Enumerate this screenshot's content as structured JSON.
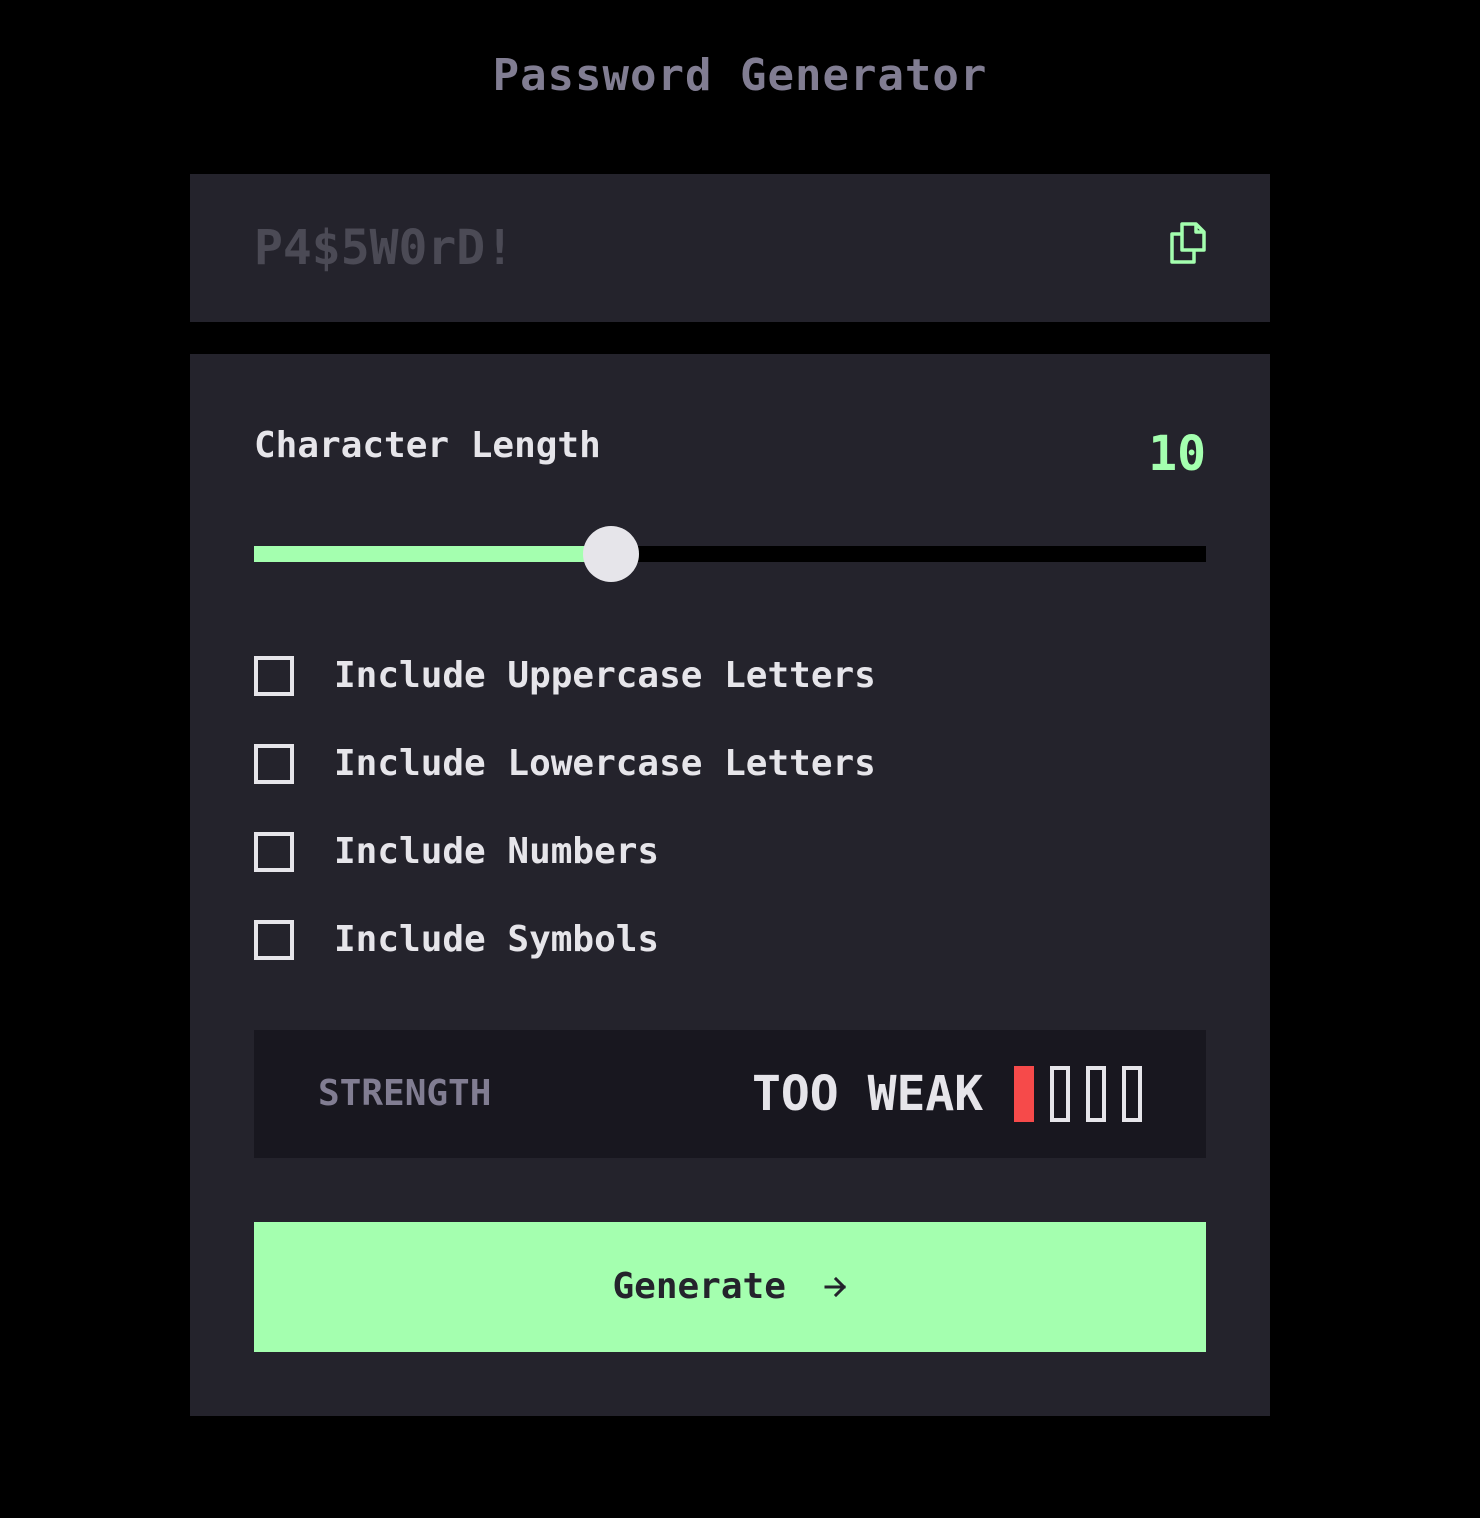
{
  "app": {
    "title": "Password Generator"
  },
  "password": {
    "placeholder": "P4$5W0rD!",
    "copy_icon": "copy-icon"
  },
  "length": {
    "label": "Character Length",
    "value": "10",
    "slider_fraction": 0.375
  },
  "options": [
    {
      "label": "Include Uppercase Letters",
      "checked": false
    },
    {
      "label": "Include Lowercase Letters",
      "checked": false
    },
    {
      "label": "Include Numbers",
      "checked": false
    },
    {
      "label": "Include Symbols",
      "checked": false
    }
  ],
  "strength": {
    "label": "STRENGTH",
    "value": "TOO WEAK",
    "level": 1,
    "max_level": 4,
    "level_color": "#f64a4a"
  },
  "generate": {
    "label": "Generate",
    "icon": "arrow-right-icon"
  },
  "colors": {
    "background": "#000000",
    "panel": "#24232c",
    "accent": "#a4ffaf",
    "text": "#e6e5ea",
    "muted": "#817d92"
  }
}
